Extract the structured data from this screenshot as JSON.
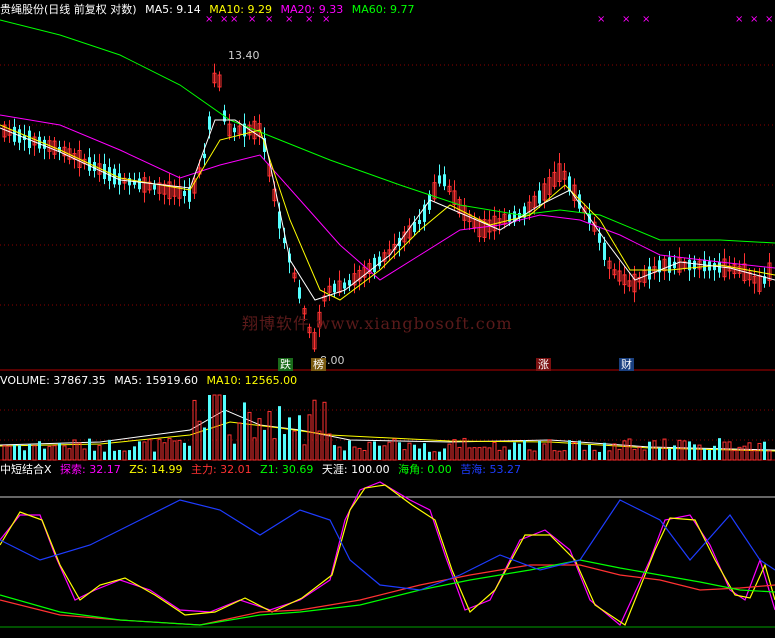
{
  "main_header": {
    "title": "贵绳股份(日线 前复权 对数)",
    "ma5": "MA5: 9.14",
    "ma10": "MA10: 9.29",
    "ma20": "MA20: 9.33",
    "ma60": "MA60: 9.77"
  },
  "volume_header": {
    "volume": "VOLUME: 37867.35",
    "ma5": "MA5: 15919.60",
    "ma10": "MA10: 12565.00"
  },
  "indicator_header": {
    "name": "中短结合X",
    "tansuo": "探索: 32.17",
    "zs": "ZS: 14.99",
    "zhuli": "主力: 32.01",
    "z1": "Z1: 30.69",
    "tianya": "天涯: 100.00",
    "haijiao": "海角: 0.00",
    "kuhai": "苦海: 53.27"
  },
  "annotations": {
    "peak_high": "13.40",
    "low": "8.00",
    "markers": [
      "跌",
      "榜",
      "涨",
      "财"
    ]
  },
  "watermark": "翔博软件 www.xiangbosoft.com",
  "colors": {
    "background": "#000000",
    "grid": "#8b0000",
    "up": "#ff3232",
    "down": "#54ffff",
    "ma5": "#ffffff",
    "ma10": "#ffff00",
    "ma20": "#ff00ff",
    "ma60": "#00ff00",
    "line_blue": "#1e3cff"
  }
}
